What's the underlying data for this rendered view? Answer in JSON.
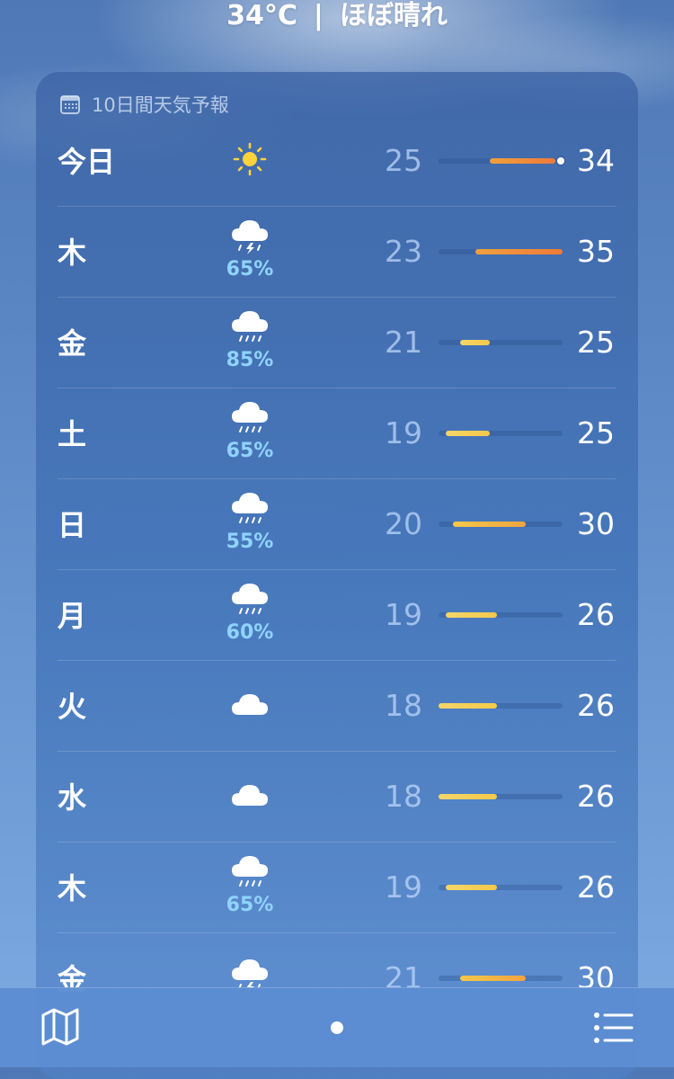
{
  "header": {
    "temperature": "34°C",
    "separator": "|",
    "condition": "ほぼ晴れ"
  },
  "forecast": {
    "title": "10日間天気予報",
    "title_icon": "calendar-icon",
    "range_min": 18,
    "range_max": 35,
    "current_temp": 34,
    "days": [
      {
        "day": "今日",
        "icon": "sun-icon",
        "pop": "",
        "low": "25",
        "high": "34",
        "low_v": 25,
        "high_v": 34,
        "show_dot": true
      },
      {
        "day": "木",
        "icon": "thunderstorm-icon",
        "pop": "65%",
        "low": "23",
        "high": "35",
        "low_v": 23,
        "high_v": 35
      },
      {
        "day": "金",
        "icon": "rain-icon",
        "pop": "85%",
        "low": "21",
        "high": "25",
        "low_v": 21,
        "high_v": 25
      },
      {
        "day": "土",
        "icon": "rain-icon",
        "pop": "65%",
        "low": "19",
        "high": "25",
        "low_v": 19,
        "high_v": 25
      },
      {
        "day": "日",
        "icon": "rain-icon",
        "pop": "55%",
        "low": "20",
        "high": "30",
        "low_v": 20,
        "high_v": 30
      },
      {
        "day": "月",
        "icon": "rain-icon",
        "pop": "60%",
        "low": "19",
        "high": "26",
        "low_v": 19,
        "high_v": 26
      },
      {
        "day": "火",
        "icon": "cloud-icon",
        "pop": "",
        "low": "18",
        "high": "26",
        "low_v": 18,
        "high_v": 26
      },
      {
        "day": "水",
        "icon": "cloud-icon",
        "pop": "",
        "low": "18",
        "high": "26",
        "low_v": 18,
        "high_v": 26
      },
      {
        "day": "木",
        "icon": "rain-icon",
        "pop": "65%",
        "low": "19",
        "high": "26",
        "low_v": 19,
        "high_v": 26
      },
      {
        "day": "金",
        "icon": "thunderstorm-icon",
        "pop": "",
        "low": "21",
        "high": "30",
        "low_v": 21,
        "high_v": 30
      }
    ]
  },
  "bottom_bar": {
    "map_icon": "map-icon",
    "page_indicator": "page-dot",
    "list_icon": "list-icon"
  }
}
